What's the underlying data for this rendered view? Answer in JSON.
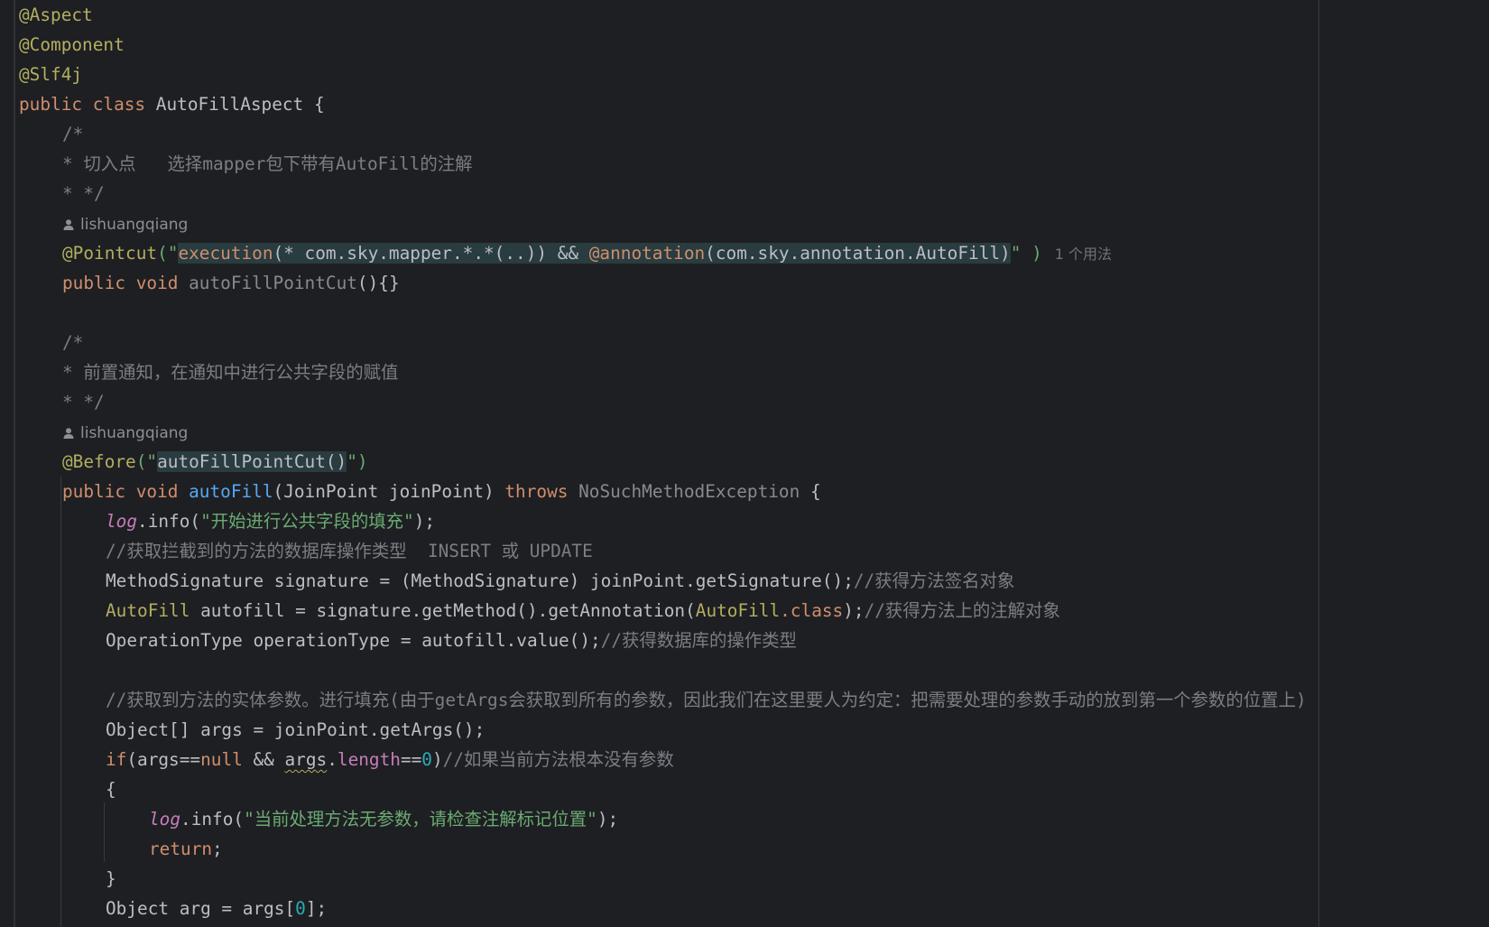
{
  "editor": {
    "language": "java",
    "colors": {
      "background": "#1e1f22",
      "keyword": "#cf8e6d",
      "annotation": "#b3ae60",
      "comment": "#7a7e85",
      "string": "#6aab73",
      "number": "#2aacb8",
      "function": "#56a8f5",
      "field": "#c77dbb"
    },
    "lines": {
      "l1": {
        "ann": "@Aspect"
      },
      "l2": {
        "ann": "@Component"
      },
      "l3": {
        "ann": "@Slf4j"
      },
      "l4": {
        "kw1": "public",
        "kw2": "class",
        "name": "AutoFillAspect",
        "brace": "{"
      },
      "l5": {
        "text": "/*"
      },
      "l6": {
        "text": "* 切入点   选择mapper包下带有AutoFill的注解"
      },
      "l7": {
        "text": "* */"
      },
      "l8": {
        "author": "lishuangqiang"
      },
      "l9": {
        "ann": "@Pointcut",
        "paren_open": "(\"",
        "exec_fn": "execution",
        "exec_args": "(* com.sky.mapper.*.*(..)) && ",
        "ann2": "@annotation",
        "ann2_args": "(com.sky.annotation.AutoFill)",
        "close": "\" )",
        "usages": "1 个用法"
      },
      "l10": {
        "kw1": "public",
        "kw2": "void",
        "name": "autoFillPointCut",
        "rest": "(){}"
      },
      "l11": {},
      "l12": {
        "text": "/*"
      },
      "l13": {
        "text": "* 前置通知，在通知中进行公共字段的赋值"
      },
      "l14": {
        "text": "* */"
      },
      "l15": {
        "author": "lishuangqiang"
      },
      "l16": {
        "ann": "@Before",
        "open": "(\"",
        "inner": "autoFillPointCut()",
        "close": "\")"
      },
      "l17": {
        "kw1": "public",
        "kw2": "void",
        "name": "autoFill",
        "params": "(JoinPoint joinPoint) ",
        "kw3": "throws",
        "exc": "NoSuchMethodException",
        "brace": " {"
      },
      "l18": {
        "log": "log",
        "call": ".info(",
        "str": "\"开始进行公共字段的填充\"",
        "end": ");"
      },
      "l19": {
        "text": "//获取拦截到的方法的数据库操作类型  INSERT 或 UPDATE"
      },
      "l20": {
        "code": "MethodSignature signature = (MethodSignature) joinPoint.getSignature();",
        "cmt": "//获得方法签名对象"
      },
      "l21": {
        "type": "AutoFill",
        "code": " autofill = signature.getMethod().getAnnotation(",
        "type2": "AutoFill",
        "cls": ".class",
        "end": ");",
        "cmt": "//获得方法上的注解对象"
      },
      "l22": {
        "code": "OperationType operationType = autofill.value();",
        "cmt": "//获得数据库的操作类型"
      },
      "l23": {},
      "l24": {
        "text": "//获取到方法的实体参数。进行填充(由于getArgs会获取到所有的参数，因此我们在这里要人为约定：把需要处理的参数手动的放到第一个参数的位置上)"
      },
      "l25": {
        "code": "Object[] args = joinPoint.getArgs();"
      },
      "l26": {
        "kw": "if",
        "p1": "(args==",
        "nul": "null",
        "p2": " && ",
        "args": "args",
        "dot": ".",
        "len": "length",
        "eq": "==",
        "zero": "0",
        "close": ")",
        "cmt": "//如果当前方法根本没有参数"
      },
      "l27": {
        "text": "{"
      },
      "l28": {
        "log": "log",
        "call": ".info(",
        "str": "\"当前处理方法无参数，请检查注解标记位置\"",
        "end": ");"
      },
      "l29": {
        "kw": "return",
        "end": ";"
      },
      "l30": {
        "text": "}"
      },
      "l31": {
        "code": "Object arg = args[",
        "zero": "0",
        "end": "];"
      }
    }
  }
}
